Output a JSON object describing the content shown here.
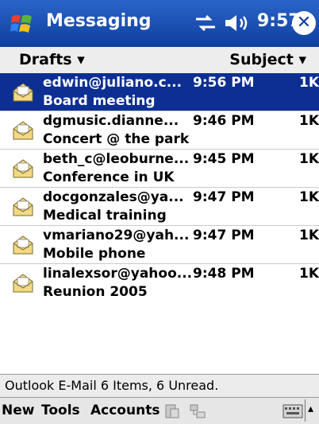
{
  "titlebar": {
    "app_title": "Messaging",
    "time": "9:57",
    "icons": [
      "start-flag-icon",
      "connectivity-icon",
      "volume-icon",
      "close-icon"
    ],
    "close_glyph": "✕"
  },
  "header": {
    "folder_label": "Drafts ▾",
    "sort_label": "Subject ▾"
  },
  "messages": [
    {
      "from": "edwin@juliano.c...",
      "time": "9:56 PM",
      "size": "1K",
      "subject": "Board meeting",
      "selected": true
    },
    {
      "from": "dgmusic.dianne...",
      "time": "9:46 PM",
      "size": "1K",
      "subject": "Concert @ the park",
      "selected": false
    },
    {
      "from": "beth_c@leoburne...",
      "time": "9:45 PM",
      "size": "1K",
      "subject": "Conference in UK",
      "selected": false
    },
    {
      "from": "docgonzales@ya...",
      "time": "9:47 PM",
      "size": "1K",
      "subject": "Medical training",
      "selected": false
    },
    {
      "from": "vmariano29@yah...",
      "time": "9:47 PM",
      "size": "1K",
      "subject": "Mobile phone",
      "selected": false
    },
    {
      "from": "linalexsor@yahoo...",
      "time": "9:48 PM",
      "size": "1K",
      "subject": "Reunion 2005",
      "selected": false
    }
  ],
  "status": {
    "text": "Outlook E-Mail  6 Items, 6 Unread."
  },
  "menubar": {
    "new_label": "New",
    "tools_label": "Tools",
    "accounts_label": "Accounts",
    "icons": [
      "send-receive-icon",
      "folder-tree-icon",
      "keyboard-icon",
      "sip-arrow-icon"
    ],
    "sip_glyph": "▴"
  },
  "colors": {
    "titlebar": "#0e3f9e",
    "selected_row": "#0d2f93"
  }
}
